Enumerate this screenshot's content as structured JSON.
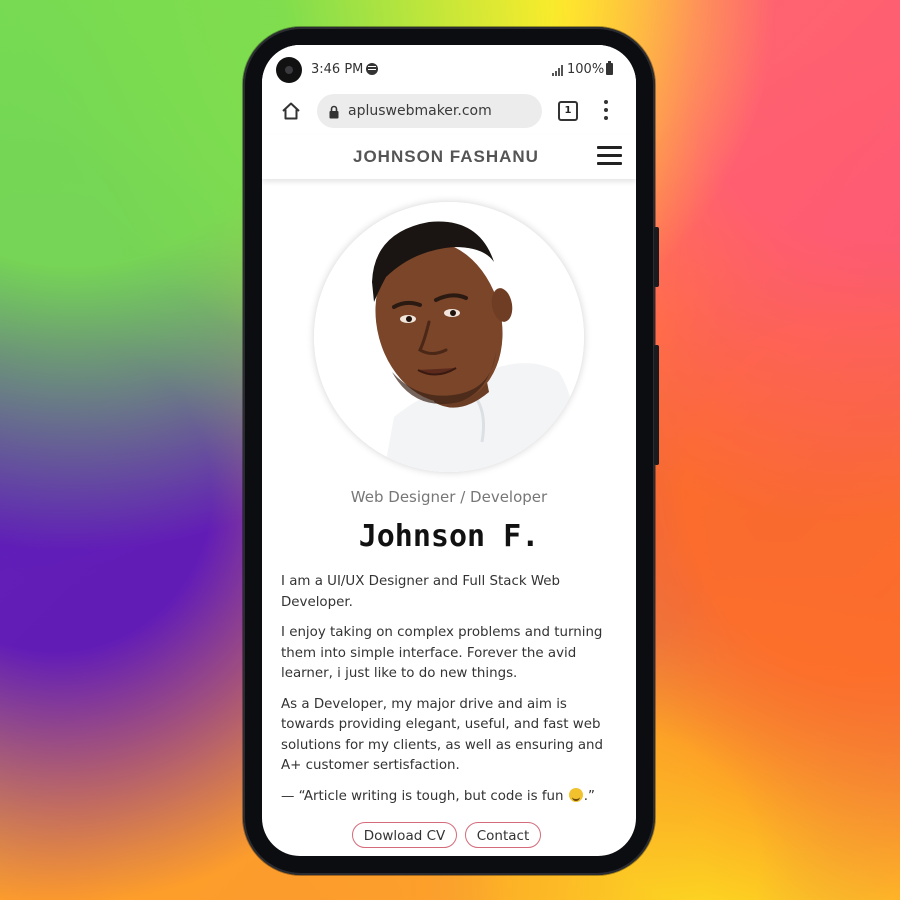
{
  "status_bar": {
    "time": "3:46 PM",
    "battery": "100%"
  },
  "browser": {
    "url": "apluswebmaker.com",
    "tab_count": "1"
  },
  "site": {
    "brand": "JOHNSON FASHANU"
  },
  "profile": {
    "role": "Web Designer / Developer",
    "name": "Johnson F.",
    "bio": [
      "I am a UI/UX Designer and Full Stack Web Developer.",
      "I enjoy taking on complex problems and turning them into simple interface. Forever the avid learner, i just like to do new things.",
      "As a Developer, my major drive and aim is towards providing elegant, useful, and fast web solutions for my clients, as well as ensuring and A+ customer sertisfaction."
    ],
    "quote_prefix": "— “Article writing is tough, but code is fun ",
    "quote_suffix": ".”"
  },
  "actions": {
    "download_cv": "Dowload CV",
    "contact": "Contact"
  },
  "colors": {
    "button_border": "#d46b7a",
    "url_bar_bg": "#ececec"
  },
  "icons": [
    "home-icon",
    "lock-icon",
    "tabs-icon",
    "menu-dots-icon",
    "hamburger-icon",
    "spotify-icon",
    "signal-icon",
    "battery-icon"
  ]
}
